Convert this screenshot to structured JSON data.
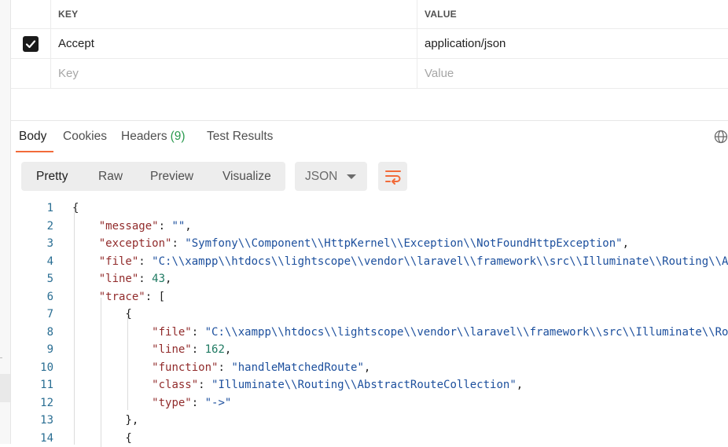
{
  "headers_table": {
    "columns": {
      "key": "KEY",
      "value": "VALUE"
    },
    "rows": [
      {
        "checked": true,
        "key": "Accept",
        "value": "application/json"
      }
    ],
    "new_row": {
      "key_placeholder": "Key",
      "value_placeholder": "Value"
    }
  },
  "response_tabs": [
    {
      "label": "Body",
      "active": true
    },
    {
      "label": "Cookies"
    },
    {
      "label": "Headers",
      "count": "(9)"
    },
    {
      "label": "Test Results"
    }
  ],
  "view_modes": [
    "Pretty",
    "Raw",
    "Preview",
    "Visualize"
  ],
  "active_view_mode": "Pretty",
  "format_select": {
    "value": "JSON"
  },
  "icons": {
    "globe": "globe-icon",
    "wrap": "wrap-lines-icon",
    "check": "check-icon",
    "caret": "chevron-down-icon"
  },
  "colors": {
    "accent": "#f26b3a",
    "count": "#2b9b4f",
    "key": "#912b2b",
    "string": "#1c4f9d",
    "number": "#1f7a62"
  },
  "code_lines": [
    {
      "num": "1",
      "tokens": [
        {
          "t": "{",
          "c": "p"
        }
      ]
    },
    {
      "num": "2",
      "tokens": [
        {
          "t": "    ",
          "c": "p"
        },
        {
          "t": "\"message\"",
          "c": "k"
        },
        {
          "t": ": ",
          "c": "p"
        },
        {
          "t": "\"\"",
          "c": "s"
        },
        {
          "t": ",",
          "c": "p"
        }
      ]
    },
    {
      "num": "3",
      "tokens": [
        {
          "t": "    ",
          "c": "p"
        },
        {
          "t": "\"exception\"",
          "c": "k"
        },
        {
          "t": ": ",
          "c": "p"
        },
        {
          "t": "\"Symfony\\\\Component\\\\HttpKernel\\\\Exception\\\\NotFoundHttpException\"",
          "c": "s"
        },
        {
          "t": ",",
          "c": "p"
        }
      ]
    },
    {
      "num": "4",
      "tokens": [
        {
          "t": "    ",
          "c": "p"
        },
        {
          "t": "\"file\"",
          "c": "k"
        },
        {
          "t": ": ",
          "c": "p"
        },
        {
          "t": "\"C:\\\\xampp\\\\htdocs\\\\lightscope\\\\vendor\\\\laravel\\\\framework\\\\src\\\\Illuminate\\\\Routing\\\\Abs",
          "c": "s"
        }
      ]
    },
    {
      "num": "5",
      "tokens": [
        {
          "t": "    ",
          "c": "p"
        },
        {
          "t": "\"line\"",
          "c": "k"
        },
        {
          "t": ": ",
          "c": "p"
        },
        {
          "t": "43",
          "c": "n"
        },
        {
          "t": ",",
          "c": "p"
        }
      ]
    },
    {
      "num": "6",
      "tokens": [
        {
          "t": "    ",
          "c": "p"
        },
        {
          "t": "\"trace\"",
          "c": "k"
        },
        {
          "t": ": [",
          "c": "p"
        }
      ]
    },
    {
      "num": "7",
      "tokens": [
        {
          "t": "        {",
          "c": "p"
        }
      ]
    },
    {
      "num": "8",
      "tokens": [
        {
          "t": "            ",
          "c": "p"
        },
        {
          "t": "\"file\"",
          "c": "k"
        },
        {
          "t": ": ",
          "c": "p"
        },
        {
          "t": "\"C:\\\\xampp\\\\htdocs\\\\lightscope\\\\vendor\\\\laravel\\\\framework\\\\src\\\\Illuminate\\\\Rout",
          "c": "s"
        }
      ]
    },
    {
      "num": "9",
      "tokens": [
        {
          "t": "            ",
          "c": "p"
        },
        {
          "t": "\"line\"",
          "c": "k"
        },
        {
          "t": ": ",
          "c": "p"
        },
        {
          "t": "162",
          "c": "n"
        },
        {
          "t": ",",
          "c": "p"
        }
      ]
    },
    {
      "num": "10",
      "tokens": [
        {
          "t": "            ",
          "c": "p"
        },
        {
          "t": "\"function\"",
          "c": "k"
        },
        {
          "t": ": ",
          "c": "p"
        },
        {
          "t": "\"handleMatchedRoute\"",
          "c": "s"
        },
        {
          "t": ",",
          "c": "p"
        }
      ]
    },
    {
      "num": "11",
      "tokens": [
        {
          "t": "            ",
          "c": "p"
        },
        {
          "t": "\"class\"",
          "c": "k"
        },
        {
          "t": ": ",
          "c": "p"
        },
        {
          "t": "\"Illuminate\\\\Routing\\\\AbstractRouteCollection\"",
          "c": "s"
        },
        {
          "t": ",",
          "c": "p"
        }
      ]
    },
    {
      "num": "12",
      "tokens": [
        {
          "t": "            ",
          "c": "p"
        },
        {
          "t": "\"type\"",
          "c": "k"
        },
        {
          "t": ": ",
          "c": "p"
        },
        {
          "t": "\"->\"",
          "c": "s"
        }
      ]
    },
    {
      "num": "13",
      "tokens": [
        {
          "t": "        },",
          "c": "p"
        }
      ]
    },
    {
      "num": "14",
      "tokens": [
        {
          "t": "        {",
          "c": "p"
        }
      ]
    }
  ]
}
